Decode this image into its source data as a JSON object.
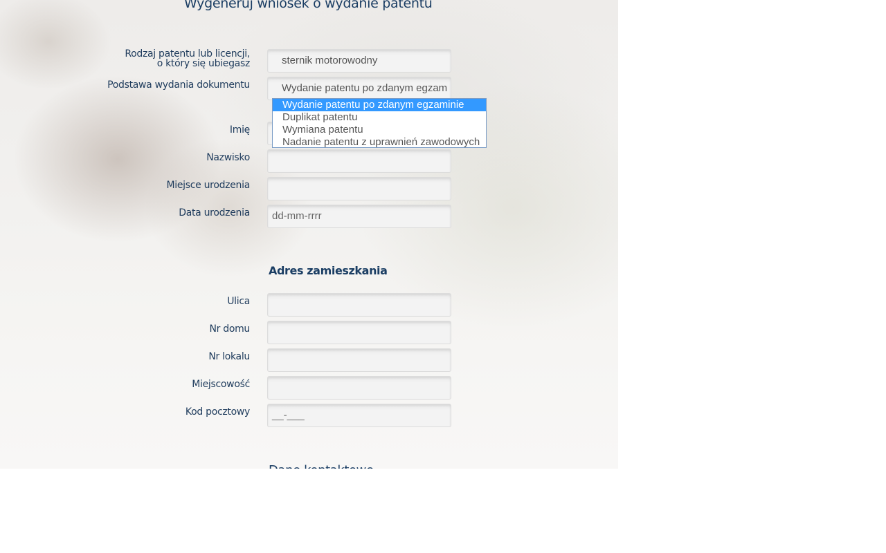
{
  "page": {
    "title": "Wygeneruj wniosek o wydanie patentu"
  },
  "form": {
    "license_type": {
      "label_line1": "Rodzaj patentu lub licencji,",
      "label_line2": "o który się ubiegasz",
      "value": "sternik motorowodny"
    },
    "basis": {
      "label": "Podstawa wydania dokumentu",
      "value": "Wydanie patentu po zdanym egzam",
      "options": [
        "Wydanie patentu po zdanym egzaminie",
        "Duplikat patentu",
        "Wymiana patentu",
        "Nadanie patentu z uprawnień zawodowych"
      ],
      "selected_index": 0
    },
    "first_name": {
      "label": "Imię",
      "value": ""
    },
    "last_name": {
      "label": "Nazwisko",
      "value": ""
    },
    "birth_place": {
      "label": "Miejsce urodzenia",
      "value": ""
    },
    "birth_date": {
      "label": "Data urodzenia",
      "placeholder": "dd-mm-rrrr"
    }
  },
  "address": {
    "heading": "Adres zamieszkania",
    "street": {
      "label": "Ulica",
      "value": ""
    },
    "house_no": {
      "label": "Nr domu",
      "value": ""
    },
    "apartment_no": {
      "label": "Nr lokalu",
      "value": ""
    },
    "city": {
      "label": "Miejscowość",
      "value": ""
    },
    "postal_code": {
      "label": "Kod pocztowy",
      "mask": "__-___"
    }
  },
  "contact": {
    "heading_partial": "Dane kontaktowe"
  },
  "colors": {
    "text_primary": "#1a3d63",
    "dropdown_highlight": "#3399ff",
    "dropdown_border": "#7a9cc6",
    "field_bg": "#f3f3f3",
    "page_bg": "#ffffff"
  }
}
